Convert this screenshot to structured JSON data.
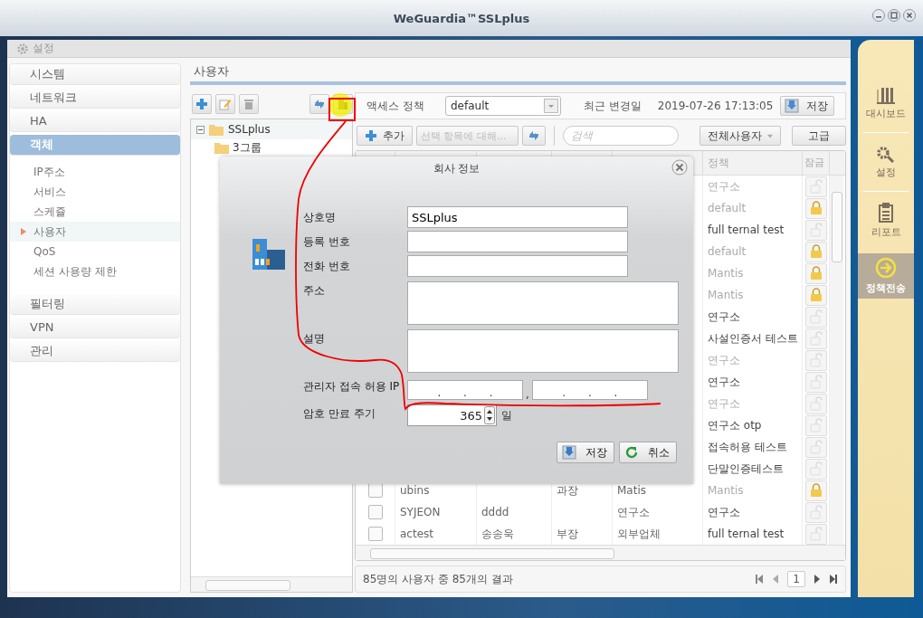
{
  "window": {
    "title": "WeGuardia™SSLplus"
  },
  "breadcrumb": "설정",
  "nav": [
    {
      "label": "시스템",
      "selected": false
    },
    {
      "label": "네트워크",
      "selected": false
    },
    {
      "label": "HA",
      "selected": false
    },
    {
      "label": "객체",
      "selected": true,
      "children": [
        {
          "label": "IP주소",
          "selected": false
        },
        {
          "label": "서비스",
          "selected": false
        },
        {
          "label": "스케쥴",
          "selected": false
        },
        {
          "label": "사용자",
          "selected": true
        },
        {
          "label": "QoS",
          "selected": false
        },
        {
          "label": "세션 사용량 제한",
          "selected": false
        }
      ]
    },
    {
      "label": "필터링",
      "selected": false
    },
    {
      "label": "VPN",
      "selected": false
    },
    {
      "label": "관리",
      "selected": false
    }
  ],
  "section_title": "사용자",
  "tree": {
    "label": "SSLplus",
    "expanded": true,
    "children": [
      {
        "label": "3그룹"
      }
    ]
  },
  "policy_bar": {
    "label": "액세스 정책",
    "value": "default",
    "changed_label": "최근 변경일",
    "changed_at": "2019-07-26 17:13:05",
    "save": "저장"
  },
  "toolbar": {
    "add": "추가",
    "bulk": "선택 항목에 대해...",
    "bulk_disabled": true,
    "search_placeholder": "검색",
    "filter": "전체사용자",
    "advanced": "고급"
  },
  "table": {
    "columns": [
      "정책",
      "잠금"
    ],
    "rows": [
      {
        "policy": "연구소",
        "dimmed": true,
        "locked": false
      },
      {
        "policy": "default",
        "dimmed": true,
        "locked": true
      },
      {
        "policy": "full ternal test",
        "dimmed": false,
        "locked": false
      },
      {
        "policy": "default",
        "dimmed": true,
        "locked": true
      },
      {
        "policy": "Mantis",
        "dimmed": true,
        "locked": true
      },
      {
        "policy": "Mantis",
        "dimmed": true,
        "locked": true
      },
      {
        "policy": "연구소",
        "dimmed": false,
        "locked": false
      },
      {
        "policy": "사설인증서 테스트",
        "dimmed": false,
        "locked": false
      },
      {
        "policy": "연구소",
        "dimmed": true,
        "locked": false
      },
      {
        "policy": "연구소",
        "dimmed": false,
        "locked": false
      },
      {
        "policy": "연구소",
        "dimmed": true,
        "locked": false
      },
      {
        "policy": "연구소 otp",
        "dimmed": false,
        "locked": false
      },
      {
        "policy": "접속허용 테스트",
        "dimmed": false,
        "locked": false
      },
      {
        "policy": "단말인증테스트",
        "dimmed": false,
        "locked": false
      },
      {
        "checked": false,
        "column_1": "ubins",
        "column_3": "과장",
        "column_4": "Matis",
        "policy": "Mantis",
        "dimmed": true,
        "locked": true
      },
      {
        "checked": false,
        "column_1": "SYJEON",
        "column_2": "dddd",
        "column_4": "연구소",
        "policy": "연구소",
        "dimmed": false,
        "locked": false
      },
      {
        "checked": false,
        "column_1": "actest",
        "column_2": "송송욱",
        "column_3": "부장",
        "column_4": "외부업체",
        "policy": "full ternal test",
        "dimmed": false,
        "locked": false
      }
    ]
  },
  "footer": {
    "summary": "85명의 사용자 중 85개의 결과",
    "page": "1"
  },
  "side_menu": [
    {
      "label": "대시보드",
      "kind": "chart",
      "selected": false
    },
    {
      "label": "설정",
      "kind": "gear",
      "selected": false
    },
    {
      "label": "리포트",
      "kind": "report",
      "selected": false
    },
    {
      "label": "정책전송",
      "kind": "send",
      "selected": true
    }
  ],
  "dialog": {
    "title": "회사 정보",
    "fields": [
      {
        "label": "상호명",
        "kind": "text",
        "value": "SSLplus"
      },
      {
        "label": "등록 번호",
        "kind": "text"
      },
      {
        "label": "전화 번호",
        "kind": "text"
      },
      {
        "label": "주소",
        "kind": "area"
      },
      {
        "label": "설명",
        "kind": "area"
      },
      {
        "label": "관리자 접속 허용 IP",
        "kind": "ip",
        "ip_fields": [
          {
            "separators": [
              ".",
              ".",
              "."
            ]
          },
          {
            "separators": [
              ".",
              ".",
              "."
            ]
          }
        ],
        "joiner": ","
      },
      {
        "label": "암호 만료 주기",
        "kind": "spin",
        "value": "365",
        "unit": "일"
      }
    ],
    "buttons": [
      {
        "label": "저장",
        "kind": "save"
      },
      {
        "label": "취소",
        "kind": "cancel"
      }
    ]
  }
}
